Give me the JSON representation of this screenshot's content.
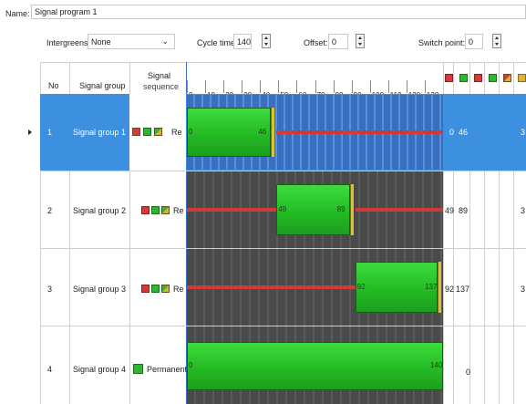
{
  "header": {
    "name_label": "Name:",
    "name_value": "Signal program 1",
    "intergreens_label": "Intergreens:",
    "intergreens_value": "None",
    "cycle_label": "Cycle time:",
    "cycle_value": "140",
    "offset_label": "Offset:",
    "offset_value": "0",
    "switch_label": "Switch point:",
    "switch_value": "0"
  },
  "columns": {
    "no": "No",
    "signal_group": "Signal group",
    "signal_sequence_1": "Signal",
    "signal_sequence_2": "sequence"
  },
  "ticks": [
    "0",
    "10",
    "20",
    "30",
    "40",
    "50",
    "60",
    "70",
    "80",
    "90",
    "100",
    "110",
    "120",
    "130"
  ],
  "rows": [
    {
      "no": "1",
      "name": "Signal group 1",
      "sequence": "Re",
      "green_start": 0,
      "green_end": 46,
      "start_label": "0",
      "end_label": "46",
      "col_start": "0",
      "col_end": "46",
      "extra": "3",
      "selected": true
    },
    {
      "no": "2",
      "name": "Signal group 2",
      "sequence": "Re",
      "green_start": 49,
      "green_end": 89,
      "start_label": "49",
      "end_label": "89",
      "col_start": "49",
      "col_end": "89",
      "extra": "3",
      "selected": false
    },
    {
      "no": "3",
      "name": "Signal group 3",
      "sequence": "Re",
      "green_start": 92,
      "green_end": 137,
      "start_label": "92",
      "end_label": "137",
      "col_start": "92",
      "col_end": "137",
      "extra": "3",
      "selected": false
    },
    {
      "no": "4",
      "name": "Signal group 4",
      "sequence": "Permanent",
      "green_start": 0,
      "green_end": 140,
      "start_label": "0",
      "end_label": "140",
      "col_start": "",
      "col_end": "0",
      "extra": "",
      "selected": false
    }
  ],
  "colors": {
    "selected_row": "#3d8fe0",
    "grid_pattern": "#4a4a4a",
    "green": "#22b822",
    "red": "#d23a3a",
    "amber": "#d9c23a"
  }
}
